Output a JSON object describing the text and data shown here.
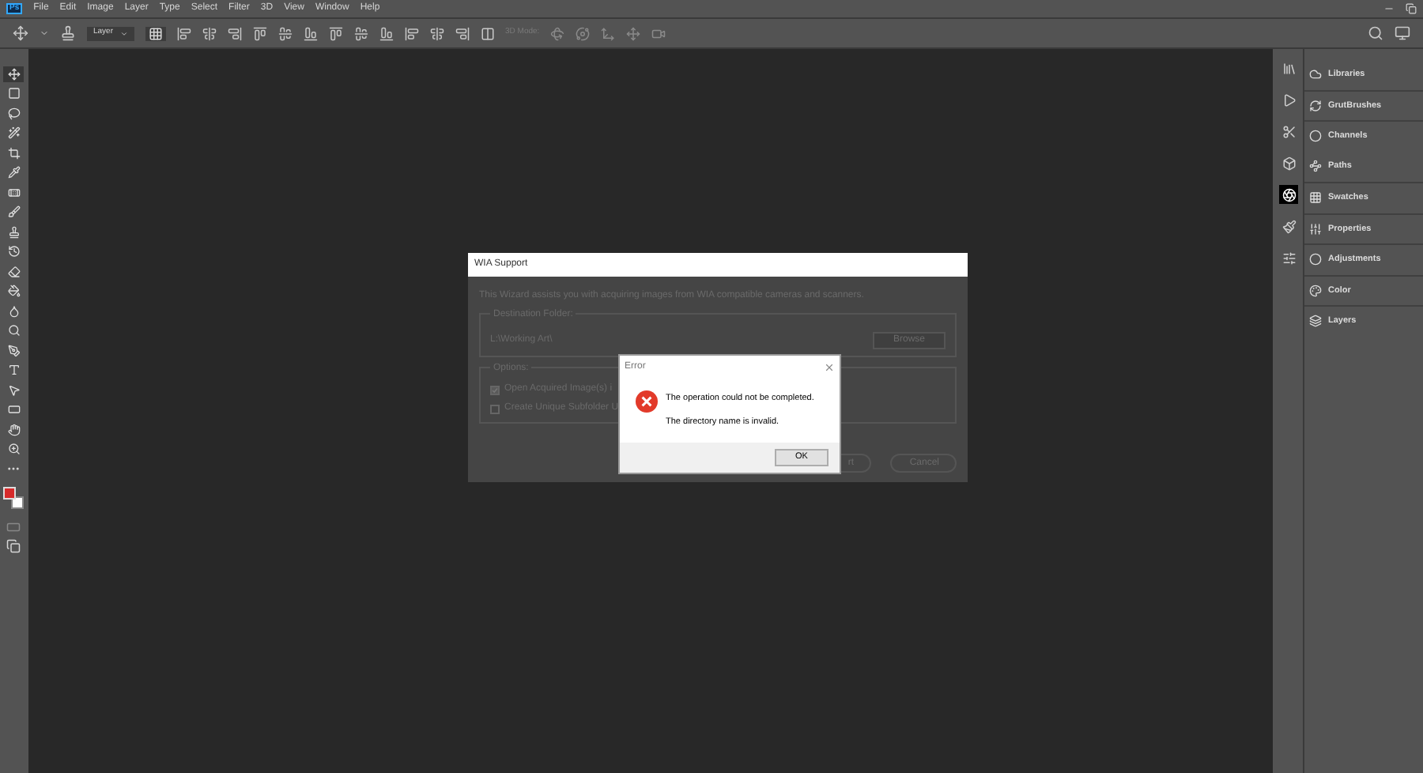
{
  "app_logo": "Ps",
  "menu": [
    "File",
    "Edit",
    "Image",
    "Layer",
    "Type",
    "Select",
    "Filter",
    "3D",
    "View",
    "Window",
    "Help"
  ],
  "options_bar": {
    "auto_select": "Layer",
    "mode_label": "3D Mode:"
  },
  "tools": [
    {
      "selected": true
    },
    {
      "selected": false
    },
    {
      "selected": false
    },
    {
      "selected": false
    },
    {
      "selected": false
    },
    {
      "selected": false
    },
    {
      "selected": false
    },
    {
      "selected": false
    },
    {
      "selected": false
    },
    {
      "selected": false
    },
    {
      "selected": false
    },
    {
      "selected": false
    },
    {
      "selected": false
    },
    {
      "selected": false
    },
    {
      "selected": false
    },
    {
      "selected": false
    },
    {
      "selected": false
    },
    {
      "selected": false
    },
    {
      "selected": false
    },
    {
      "selected": false
    }
  ],
  "panel_icons": [
    {
      "selected": false
    },
    {
      "selected": false
    },
    {
      "selected": false
    },
    {
      "selected": false
    },
    {
      "selected": true
    },
    {
      "selected": false
    },
    {
      "selected": false
    }
  ],
  "panels": [
    {
      "label": "Libraries"
    },
    {
      "label": "GrutBrushes"
    },
    {
      "label": "Channels"
    },
    {
      "label": "Paths"
    },
    {
      "label": "Swatches"
    },
    {
      "label": "Properties"
    },
    {
      "label": "Adjustments"
    },
    {
      "label": "Color"
    },
    {
      "label": "Layers"
    }
  ],
  "wia_dialog": {
    "title": "WIA Support",
    "intro": "This Wizard assists you with acquiring images from WIA compatible cameras and scanners.",
    "destination_label": "Destination Folder:",
    "destination_path": "L:\\Working Art\\",
    "browse": "Browse",
    "options_label": "Options:",
    "options": [
      {
        "label": "Open Acquired Image(s) i",
        "checked": true
      },
      {
        "label": "Create Unique Subfolder U",
        "checked": false
      }
    ],
    "buttons": [
      "rt",
      "Cancel"
    ]
  },
  "error_dialog": {
    "title": "Error",
    "message": "The operation could not be completed.",
    "detail": "The directory name is invalid.",
    "ok": "OK"
  }
}
